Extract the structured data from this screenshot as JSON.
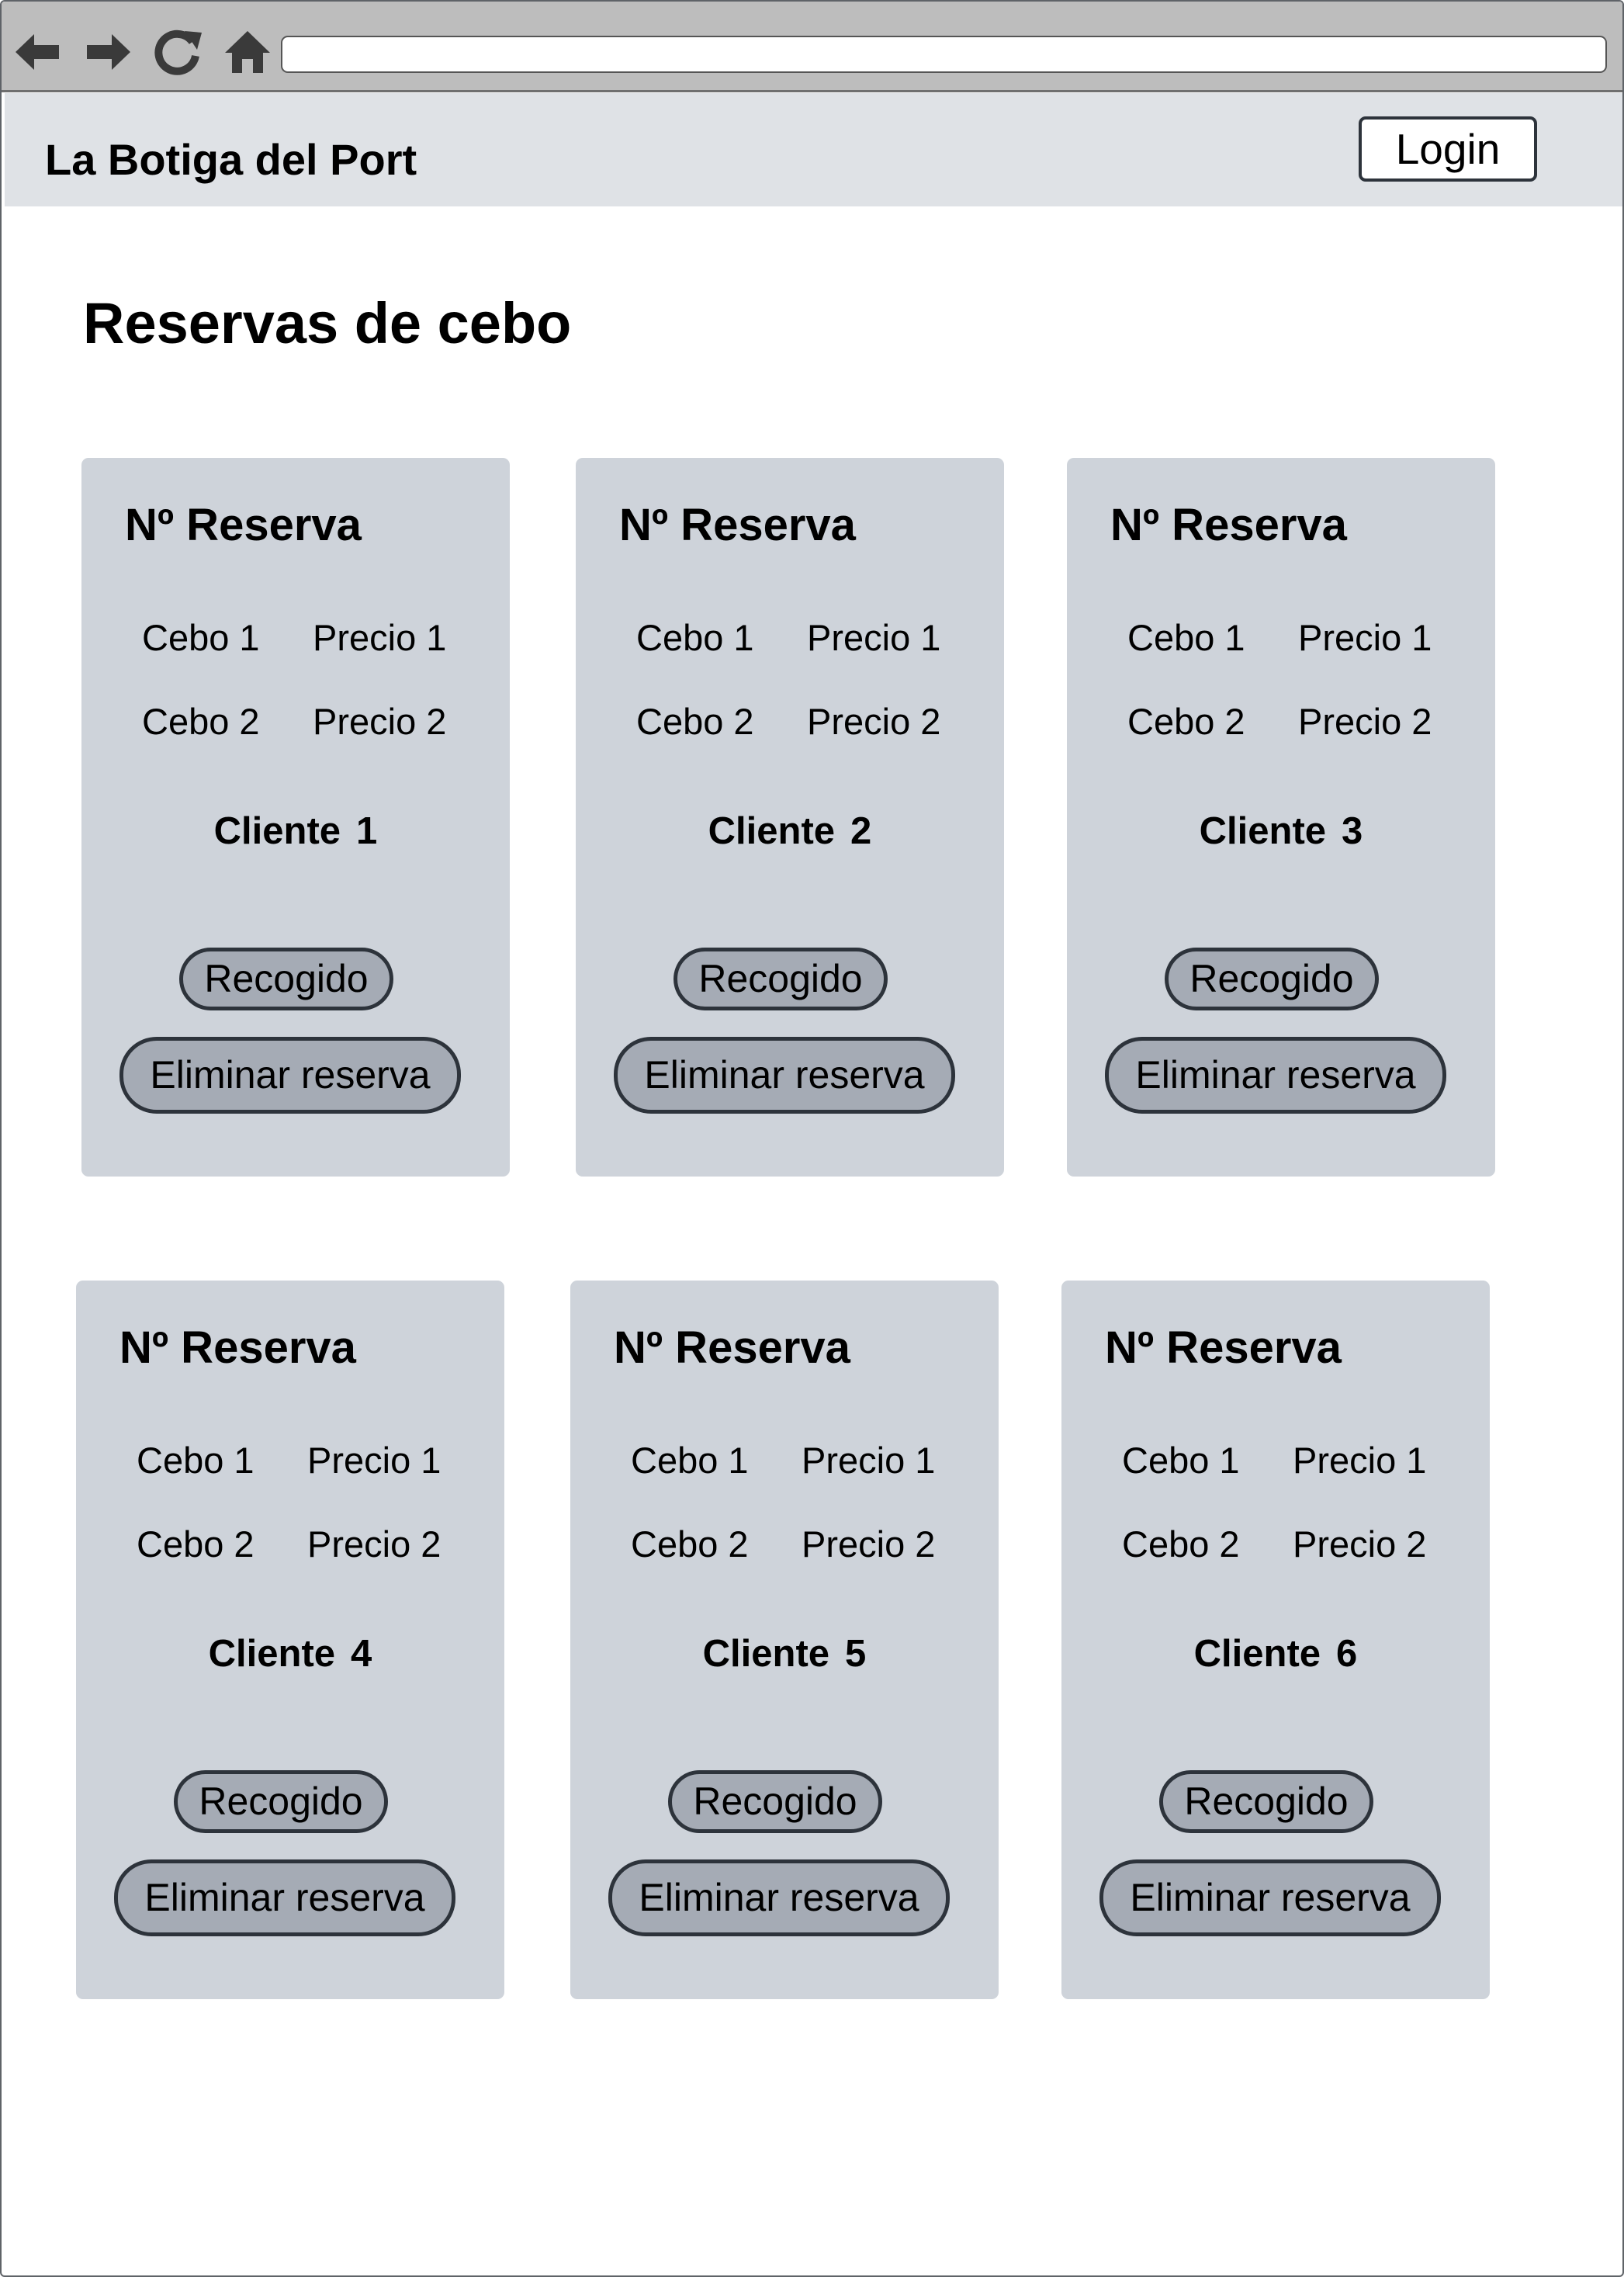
{
  "browser": {
    "icons": [
      "back-arrow-icon",
      "forward-arrow-icon",
      "reload-icon",
      "home-icon"
    ],
    "url": ""
  },
  "header": {
    "brand": "La Botiga del Port",
    "login_label": "Login"
  },
  "page": {
    "title": "Reservas de cebo"
  },
  "cards": [
    {
      "title": "Nº Reserva",
      "items": [
        {
          "name": "Cebo 1",
          "price": "Precio 1"
        },
        {
          "name": "Cebo 2",
          "price": "Precio 2"
        }
      ],
      "client_label": "Cliente",
      "client_number": "1",
      "collected_label": "Recogido",
      "delete_label": "Eliminar reserva"
    },
    {
      "title": "Nº Reserva",
      "items": [
        {
          "name": "Cebo 1",
          "price": "Precio 1"
        },
        {
          "name": "Cebo 2",
          "price": "Precio 2"
        }
      ],
      "client_label": "Cliente",
      "client_number": "2",
      "collected_label": "Recogido",
      "delete_label": "Eliminar reserva"
    },
    {
      "title": "Nº Reserva",
      "items": [
        {
          "name": "Cebo 1",
          "price": "Precio 1"
        },
        {
          "name": "Cebo 2",
          "price": "Precio 2"
        }
      ],
      "client_label": "Cliente",
      "client_number": "3",
      "collected_label": "Recogido",
      "delete_label": "Eliminar reserva"
    },
    {
      "title": "Nº Reserva",
      "items": [
        {
          "name": "Cebo 1",
          "price": "Precio 1"
        },
        {
          "name": "Cebo 2",
          "price": "Precio 2"
        }
      ],
      "client_label": "Cliente",
      "client_number": "4",
      "collected_label": "Recogido",
      "delete_label": "Eliminar reserva"
    },
    {
      "title": "Nº Reserva",
      "items": [
        {
          "name": "Cebo 1",
          "price": "Precio 1"
        },
        {
          "name": "Cebo 2",
          "price": "Precio 2"
        }
      ],
      "client_label": "Cliente",
      "client_number": "5",
      "collected_label": "Recogido",
      "delete_label": "Eliminar reserva"
    },
    {
      "title": "Nº Reserva",
      "items": [
        {
          "name": "Cebo 1",
          "price": "Precio 1"
        },
        {
          "name": "Cebo 2",
          "price": "Precio 2"
        }
      ],
      "client_label": "Cliente",
      "client_number": "6",
      "collected_label": "Recogido",
      "delete_label": "Eliminar reserva"
    }
  ]
}
